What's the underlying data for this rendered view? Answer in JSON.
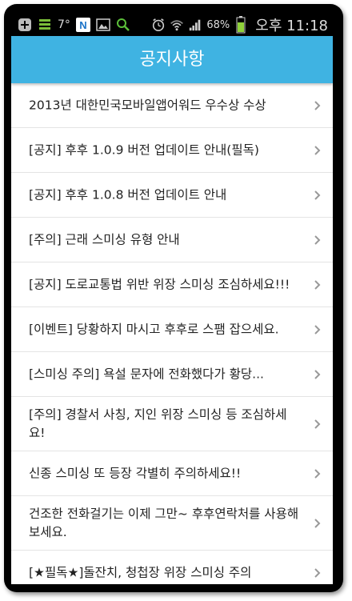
{
  "status_bar": {
    "temperature": "7°",
    "battery_percent": "68%",
    "time": "오후 11:18",
    "icons": [
      "add-icon",
      "list-icon",
      "n-app-icon",
      "gallery-icon",
      "search-icon",
      "alarm-icon",
      "wifi-icon",
      "signal-icon",
      "battery-icon"
    ]
  },
  "header": {
    "title": "공지사항",
    "color": "#3fb3e2"
  },
  "notices": [
    {
      "title": "2013년 대한민국모바일앱어워드 우수상 수상"
    },
    {
      "title": "[공지] 후후 1.0.9 버전 업데이트 안내(필독)"
    },
    {
      "title": "[공지] 후후 1.0.8 버전 업데이트 안내"
    },
    {
      "title": "[주의] 근래 스미싱 유형 안내"
    },
    {
      "title": "[공지] 도로교통법 위반 위장 스미싱 조심하세요!!!"
    },
    {
      "title": "[이벤트] 당황하지 마시고 후후로 스팸 잡으세요."
    },
    {
      "title": "[스미싱 주의] 욕설 문자에 전화했다가 황당..."
    },
    {
      "title": "[주의] 경찰서 사칭, 지인 위장 스미싱 등 조심하세요!"
    },
    {
      "title": "신종 스미싱 또 등장 각별히 주의하세요!!"
    },
    {
      "title": "건조한 전화걸기는 이제 그만~ 후후연락처를 사용해 보세요."
    },
    {
      "title": "[★필독★]돌잔치, 청첩장 위장 스미싱 주의"
    }
  ]
}
